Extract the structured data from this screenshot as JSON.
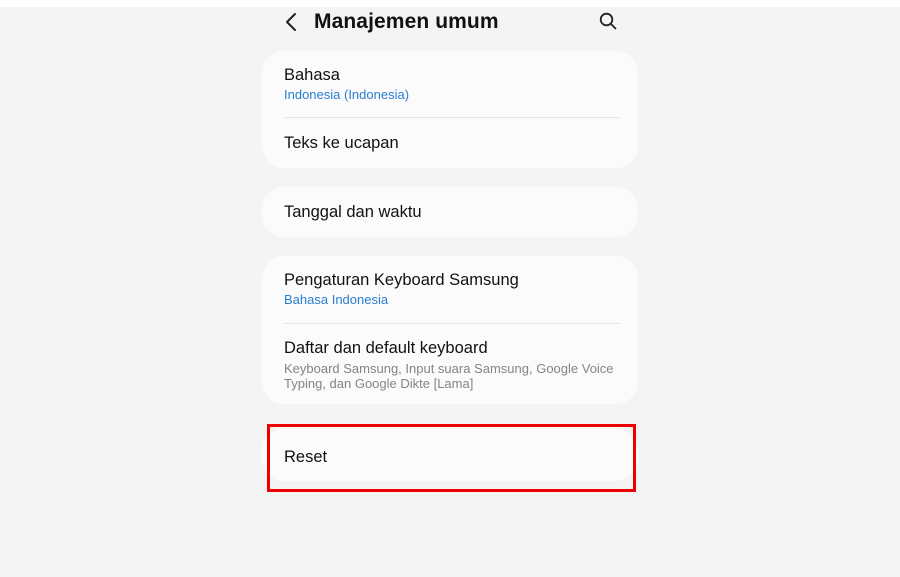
{
  "header": {
    "title": "Manajemen umum",
    "back_icon": "chevron-left-icon",
    "search_icon": "search-icon"
  },
  "groups": [
    {
      "items": [
        {
          "title": "Bahasa",
          "subtitle": "Indonesia (Indonesia)"
        },
        {
          "title": "Teks ke ucapan"
        }
      ]
    },
    {
      "items": [
        {
          "title": "Tanggal dan waktu"
        }
      ]
    },
    {
      "items": [
        {
          "title": "Pengaturan Keyboard Samsung",
          "subtitle": "Bahasa Indonesia"
        },
        {
          "title": "Daftar dan default keyboard",
          "description": "Keyboard Samsung, Input suara Samsung, Google Voice Typing, dan Google Dikte [Lama]"
        }
      ]
    },
    {
      "items": [
        {
          "title": "Reset"
        }
      ]
    }
  ],
  "colors": {
    "background": "#f4f4f4",
    "card": "#fbfbfb",
    "accent_blue": "#2b7ed0",
    "highlight": "#ee0000"
  }
}
